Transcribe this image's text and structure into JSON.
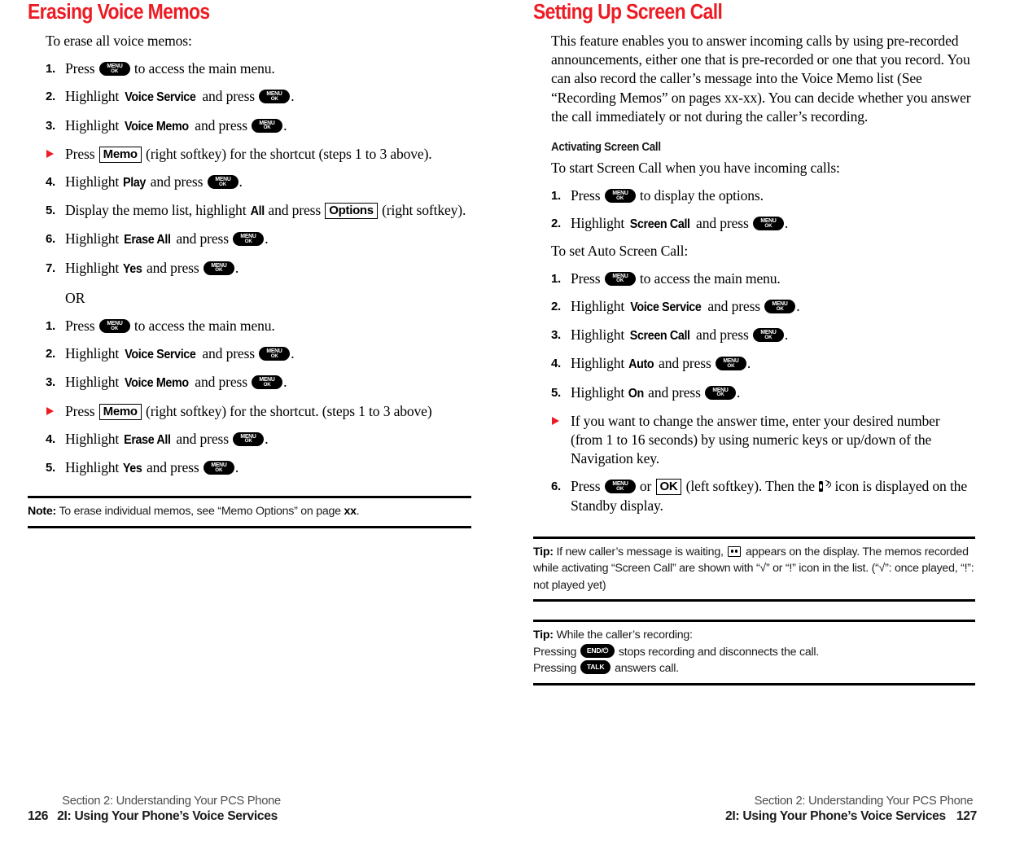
{
  "colors": {
    "accent_red": "#ED1C24",
    "text": "#000000",
    "callout_rule": "#000000"
  },
  "keys": {
    "menu_ok": {
      "line1": "MENU",
      "line2": "OK",
      "name": "menu-ok-key"
    },
    "end": {
      "label": "END/⏻",
      "name": "end-power-key"
    },
    "talk": {
      "label": "TALK",
      "name": "talk-key"
    }
  },
  "left_page": {
    "title": "Erasing Voice Memos",
    "intro": "To erase all voice memos:",
    "procedure_a": [
      {
        "num": "1.",
        "type": "number",
        "parts": [
          {
            "t": "text",
            "v": "Press "
          },
          {
            "t": "key",
            "v": "menu_ok"
          },
          {
            "t": "text",
            "v": " to access the main menu."
          }
        ]
      },
      {
        "num": "2.",
        "type": "number",
        "parts": [
          {
            "t": "text",
            "v": "Highlight "
          },
          {
            "t": "item",
            "v": "Voice Service"
          },
          {
            "t": "text",
            "v": " and press "
          },
          {
            "t": "key",
            "v": "menu_ok"
          },
          {
            "t": "text",
            "v": "."
          }
        ]
      },
      {
        "num": "3.",
        "type": "number",
        "parts": [
          {
            "t": "text",
            "v": "Highlight "
          },
          {
            "t": "item",
            "v": "Voice Memo"
          },
          {
            "t": "text",
            "v": " and press "
          },
          {
            "t": "key",
            "v": "menu_ok"
          },
          {
            "t": "text",
            "v": "."
          }
        ]
      },
      {
        "num": "",
        "type": "bullet",
        "parts": [
          {
            "t": "text",
            "v": "Press "
          },
          {
            "t": "softkey",
            "v": "Memo"
          },
          {
            "t": "text",
            "v": " (right softkey) for the shortcut (steps 1 to 3 above)."
          }
        ]
      },
      {
        "num": "4.",
        "type": "number",
        "parts": [
          {
            "t": "text",
            "v": "Highlight "
          },
          {
            "t": "item",
            "v": "Play"
          },
          {
            "t": "text",
            "v": " and press "
          },
          {
            "t": "key",
            "v": "menu_ok"
          },
          {
            "t": "text",
            "v": "."
          }
        ]
      },
      {
        "num": "5.",
        "type": "number",
        "parts": [
          {
            "t": "text",
            "v": "Display the memo list, highlight "
          },
          {
            "t": "item",
            "v": "All"
          },
          {
            "t": "text",
            "v": " and press "
          },
          {
            "t": "softkey",
            "v": "Options"
          },
          {
            "t": "text",
            "v": " (right softkey)."
          }
        ]
      },
      {
        "num": "6.",
        "type": "number",
        "parts": [
          {
            "t": "text",
            "v": "Highlight "
          },
          {
            "t": "item",
            "v": "Erase All"
          },
          {
            "t": "text",
            "v": " and press "
          },
          {
            "t": "key",
            "v": "menu_ok"
          },
          {
            "t": "text",
            "v": "."
          }
        ]
      },
      {
        "num": "7.",
        "type": "number",
        "parts": [
          {
            "t": "text",
            "v": "Highlight "
          },
          {
            "t": "item",
            "v": "Yes"
          },
          {
            "t": "text",
            "v": " and press "
          },
          {
            "t": "key",
            "v": "menu_ok"
          },
          {
            "t": "text",
            "v": "."
          }
        ]
      }
    ],
    "or_label": "OR",
    "procedure_b": [
      {
        "num": "1.",
        "type": "number",
        "parts": [
          {
            "t": "text",
            "v": "Press "
          },
          {
            "t": "key",
            "v": "menu_ok"
          },
          {
            "t": "text",
            "v": " to access the main menu."
          }
        ]
      },
      {
        "num": "2.",
        "type": "number",
        "parts": [
          {
            "t": "text",
            "v": "Highlight "
          },
          {
            "t": "item",
            "v": "Voice Service"
          },
          {
            "t": "text",
            "v": " and press "
          },
          {
            "t": "key",
            "v": "menu_ok"
          },
          {
            "t": "text",
            "v": "."
          }
        ]
      },
      {
        "num": "3.",
        "type": "number",
        "parts": [
          {
            "t": "text",
            "v": "Highlight "
          },
          {
            "t": "item",
            "v": "Voice Memo"
          },
          {
            "t": "text",
            "v": " and press "
          },
          {
            "t": "key",
            "v": "menu_ok"
          },
          {
            "t": "text",
            "v": "."
          }
        ]
      },
      {
        "num": "",
        "type": "bullet",
        "parts": [
          {
            "t": "text",
            "v": "Press "
          },
          {
            "t": "softkey",
            "v": "Memo"
          },
          {
            "t": "text",
            "v": " (right softkey) for the shortcut. (steps 1 to 3 above)"
          }
        ]
      },
      {
        "num": "4.",
        "type": "number",
        "parts": [
          {
            "t": "text",
            "v": "Highlight "
          },
          {
            "t": "item",
            "v": "Erase All"
          },
          {
            "t": "text",
            "v": " and press "
          },
          {
            "t": "key",
            "v": "menu_ok"
          },
          {
            "t": "text",
            "v": "."
          }
        ]
      },
      {
        "num": "5.",
        "type": "number",
        "parts": [
          {
            "t": "text",
            "v": "Highlight "
          },
          {
            "t": "item",
            "v": "Yes"
          },
          {
            "t": "text",
            "v": " and press "
          },
          {
            "t": "key",
            "v": "menu_ok"
          },
          {
            "t": "text",
            "v": "."
          }
        ]
      }
    ],
    "note": {
      "lead": "Note:",
      "parts": [
        {
          "t": "text",
          "v": " To erase individual memos, see “Memo Options” on page "
        },
        {
          "t": "bold",
          "v": "xx"
        },
        {
          "t": "text",
          "v": "."
        }
      ]
    },
    "footer": {
      "line1": "Section 2: Understanding Your PCS Phone",
      "line2": "2I: Using Your Phone’s Voice Services",
      "page": "126"
    }
  },
  "right_page": {
    "title": "Setting Up Screen Call",
    "intro": "This feature enables you to answer incoming calls by using pre-recorded announcements, either one that is pre-recorded or one that you record. You can also record the caller’s message into the Voice Memo list (See “Recording Memos” on pages xx-xx). You can decide whether you answer the call immediately or not during the caller’s recording.",
    "subhead": "Activating Screen Call",
    "lead_a": "To start Screen Call when you have incoming calls:",
    "procedure_a": [
      {
        "num": "1.",
        "type": "number",
        "parts": [
          {
            "t": "text",
            "v": "Press "
          },
          {
            "t": "key",
            "v": "menu_ok"
          },
          {
            "t": "text",
            "v": " to display the options."
          }
        ]
      },
      {
        "num": "2.",
        "type": "number",
        "parts": [
          {
            "t": "text",
            "v": "Highlight "
          },
          {
            "t": "item",
            "v": "Screen Call"
          },
          {
            "t": "text",
            "v": " and press "
          },
          {
            "t": "key",
            "v": "menu_ok"
          },
          {
            "t": "text",
            "v": "."
          }
        ]
      }
    ],
    "lead_b": "To set Auto Screen Call:",
    "procedure_b": [
      {
        "num": "1.",
        "type": "number",
        "parts": [
          {
            "t": "text",
            "v": "Press "
          },
          {
            "t": "key",
            "v": "menu_ok"
          },
          {
            "t": "text",
            "v": " to access the main menu."
          }
        ]
      },
      {
        "num": "2.",
        "type": "number",
        "parts": [
          {
            "t": "text",
            "v": "Highlight "
          },
          {
            "t": "item",
            "v": "Voice Service"
          },
          {
            "t": "text",
            "v": " and press "
          },
          {
            "t": "key",
            "v": "menu_ok"
          },
          {
            "t": "text",
            "v": "."
          }
        ]
      },
      {
        "num": "3.",
        "type": "number",
        "parts": [
          {
            "t": "text",
            "v": "Highlight "
          },
          {
            "t": "item",
            "v": "Screen Call"
          },
          {
            "t": "text",
            "v": " and press "
          },
          {
            "t": "key",
            "v": "menu_ok"
          },
          {
            "t": "text",
            "v": "."
          }
        ]
      },
      {
        "num": "4.",
        "type": "number",
        "parts": [
          {
            "t": "text",
            "v": "Highlight "
          },
          {
            "t": "item",
            "v": "Auto"
          },
          {
            "t": "text",
            "v": " and press "
          },
          {
            "t": "key",
            "v": "menu_ok"
          },
          {
            "t": "text",
            "v": "."
          }
        ]
      },
      {
        "num": "5.",
        "type": "number",
        "parts": [
          {
            "t": "text",
            "v": "Highlight "
          },
          {
            "t": "item",
            "v": "On"
          },
          {
            "t": "text",
            "v": " and press "
          },
          {
            "t": "key",
            "v": "menu_ok"
          },
          {
            "t": "text",
            "v": "."
          }
        ]
      },
      {
        "num": "",
        "type": "bullet",
        "parts": [
          {
            "t": "text",
            "v": "If you want to change the answer time, enter your desired number (from 1 to 16 seconds) by using numeric keys or up/down of the Navigation key."
          }
        ]
      },
      {
        "num": "6.",
        "type": "number",
        "parts": [
          {
            "t": "text",
            "v": "Press "
          },
          {
            "t": "key",
            "v": "menu_ok"
          },
          {
            "t": "text",
            "v": " or "
          },
          {
            "t": "softkey",
            "v": "OK"
          },
          {
            "t": "text",
            "v": " (left softkey). Then the "
          },
          {
            "t": "icon",
            "v": "screen-call-icon"
          },
          {
            "t": "text",
            "v": " icon is displayed on the Standby display."
          }
        ]
      }
    ],
    "tip1": {
      "lead": "Tip:",
      "parts": [
        {
          "t": "text",
          "v": " If new caller’s message is waiting, "
        },
        {
          "t": "icon",
          "v": "memo-waiting-icon"
        },
        {
          "t": "text",
          "v": " appears on the display. The memos recorded while activating “Screen Call” are shown with “√” or “!” icon in the list. (“√”: once played, “!”: not played yet)"
        }
      ]
    },
    "tip2": {
      "lead": "Tip:",
      "line1_text": " While the caller’s recording:",
      "line2": [
        {
          "t": "text",
          "v": "Pressing "
        },
        {
          "t": "key",
          "v": "end"
        },
        {
          "t": "text",
          "v": " stops recording and disconnects the call."
        }
      ],
      "line3": [
        {
          "t": "text",
          "v": "Pressing "
        },
        {
          "t": "key",
          "v": "talk"
        },
        {
          "t": "text",
          "v": " answers call."
        }
      ]
    },
    "footer": {
      "line1": "Section 2: Understanding Your PCS Phone",
      "line2": "2I: Using Your Phone’s Voice Services",
      "page": "127"
    }
  }
}
